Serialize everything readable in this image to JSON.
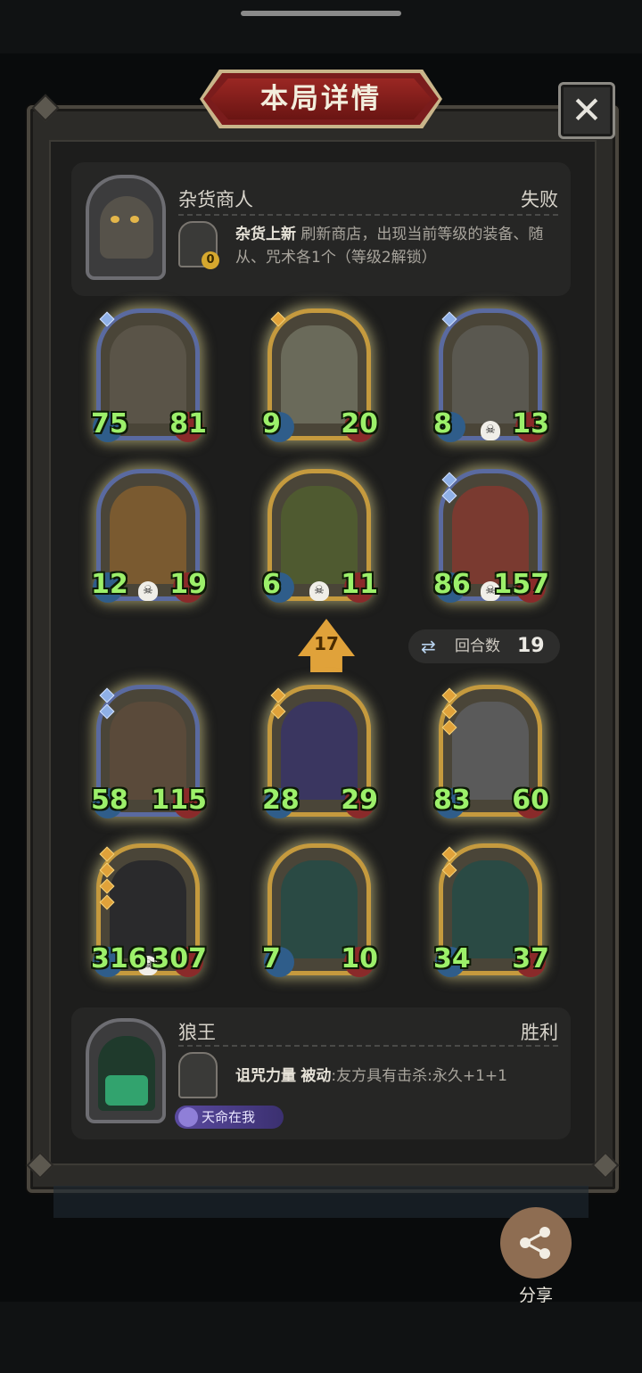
{
  "title": "本局详情",
  "close_symbol": "✕",
  "top_player": {
    "name": "杂货商人",
    "result": "失败",
    "skill_name": "杂货上新",
    "skill_desc": "刷新商店，出现当前等级的装备、随从、咒术各1个（等级2解锁）",
    "coin_count": "0"
  },
  "top_board": [
    {
      "atk": "75",
      "hp": "81",
      "frame": "blue",
      "gems": [
        "b"
      ],
      "skull": false,
      "art": "#5a5448"
    },
    {
      "atk": "9",
      "hp": "20",
      "frame": "gold",
      "gems": [
        "g"
      ],
      "skull": false,
      "art": "#6a6a5a"
    },
    {
      "atk": "8",
      "hp": "13",
      "frame": "blue",
      "gems": [
        "b"
      ],
      "skull": true,
      "art": "#5a5850"
    },
    {
      "atk": "12",
      "hp": "19",
      "frame": "blue",
      "gems": [],
      "skull": true,
      "art": "#7a5a30"
    },
    {
      "atk": "6",
      "hp": "11",
      "frame": "gold",
      "gems": [],
      "skull": true,
      "art": "#4f5a30"
    },
    {
      "atk": "86",
      "hp": "157",
      "frame": "blue",
      "gems": [
        "b",
        "b"
      ],
      "skull": true,
      "art": "#7a3a30"
    }
  ],
  "tier": "17",
  "round": {
    "label": "回合数",
    "value": "19"
  },
  "bottom_board": [
    {
      "atk": "58",
      "hp": "115",
      "frame": "blue",
      "gems": [
        "b",
        "b"
      ],
      "skull": false,
      "art": "#5a4a3a"
    },
    {
      "atk": "28",
      "hp": "29",
      "frame": "gold",
      "gems": [
        "g",
        "g"
      ],
      "skull": false,
      "art": "#3a3660"
    },
    {
      "atk": "83",
      "hp": "60",
      "frame": "gold",
      "gems": [
        "g",
        "g",
        "g"
      ],
      "skull": false,
      "art": "#5a5a5a"
    },
    {
      "atk": "316",
      "hp": "307",
      "frame": "gold",
      "gems": [
        "g",
        "g",
        "g",
        "g"
      ],
      "skull": true,
      "art": "#2a2a2c"
    },
    {
      "atk": "7",
      "hp": "10",
      "frame": "gold",
      "gems": [],
      "skull": false,
      "art": "#2a4a44"
    },
    {
      "atk": "34",
      "hp": "37",
      "frame": "gold",
      "gems": [
        "g",
        "g"
      ],
      "skull": false,
      "art": "#2a4a44"
    }
  ],
  "bottom_player": {
    "name": "狼王",
    "result": "胜利",
    "skill_name": "诅咒力量",
    "skill_type": "被动",
    "skill_desc": ":友方具有击杀:永久+1+1",
    "badge": "天命在我"
  },
  "share_label": "分享",
  "colors": {
    "gold_frame": "#c59a3e",
    "blue_frame": "#5a6aa0",
    "stat_green": "#9cf06a",
    "banner_red": "#8a221f"
  }
}
